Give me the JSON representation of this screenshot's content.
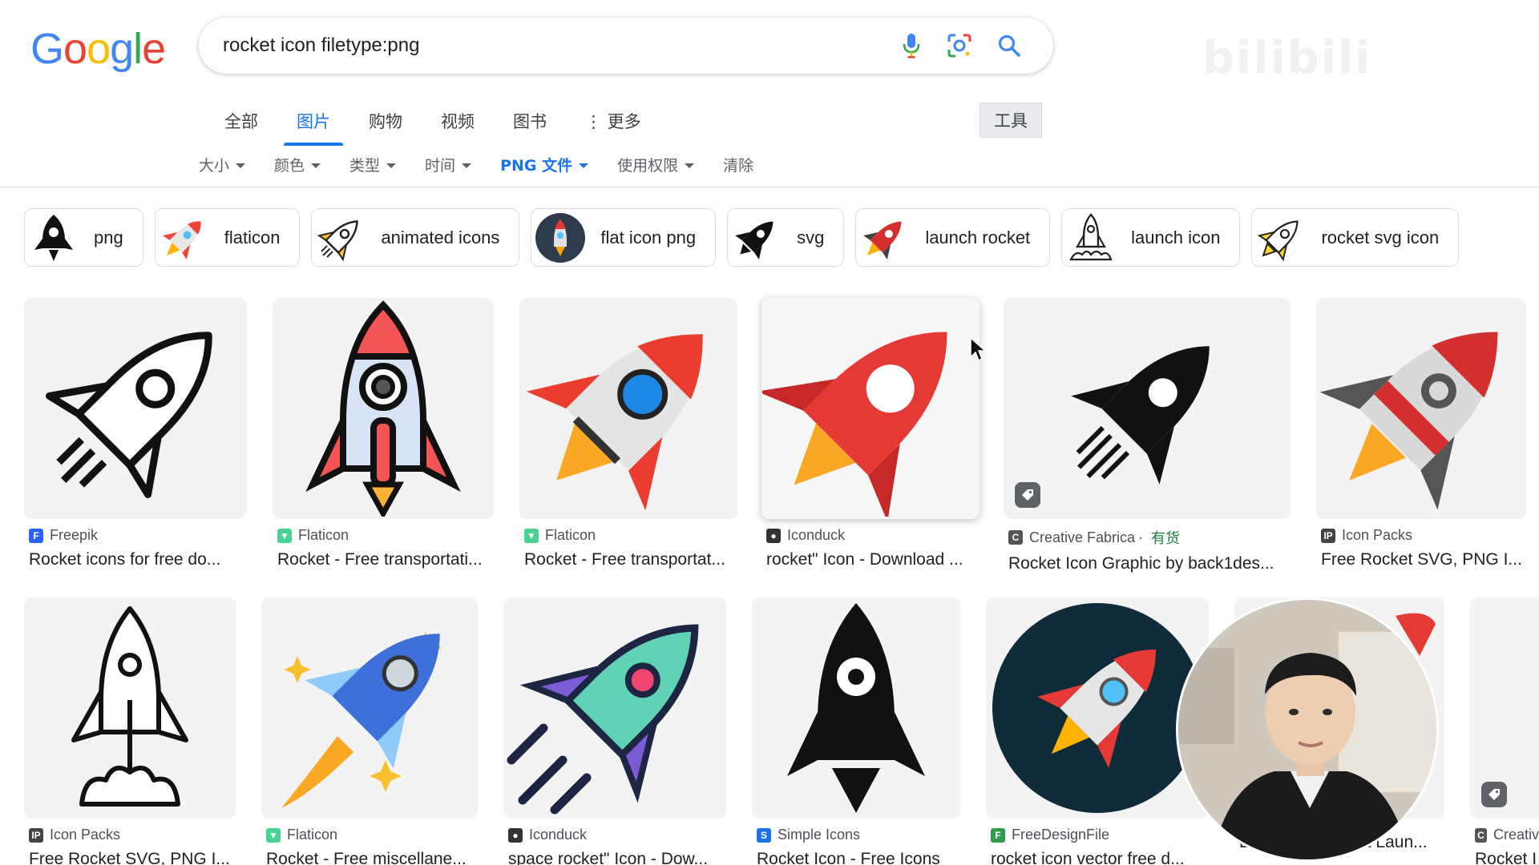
{
  "logo": {
    "letters": [
      "G",
      "o",
      "o",
      "g",
      "l",
      "e"
    ],
    "colors": [
      "#4285f4",
      "#ea4335",
      "#fbbc05",
      "#4285f4",
      "#34a853",
      "#ea4335"
    ]
  },
  "search": {
    "query": "rocket icon filetype:png",
    "icons": [
      "microphone-icon",
      "lens-icon",
      "search-icon"
    ]
  },
  "tabs": [
    {
      "label": "全部",
      "active": false
    },
    {
      "label": "图片",
      "active": true
    },
    {
      "label": "购物",
      "active": false
    },
    {
      "label": "视频",
      "active": false
    },
    {
      "label": "图书",
      "active": false
    },
    {
      "label": "⋮ 更多",
      "active": false
    }
  ],
  "tools_label": "工具",
  "filters": [
    {
      "label": "大小",
      "dropdown": true,
      "active": false
    },
    {
      "label": "颜色",
      "dropdown": true,
      "active": false
    },
    {
      "label": "类型",
      "dropdown": true,
      "active": false
    },
    {
      "label": "时间",
      "dropdown": true,
      "active": false
    },
    {
      "label": "PNG 文件",
      "dropdown": true,
      "active": true
    },
    {
      "label": "使用权限",
      "dropdown": true,
      "active": false
    },
    {
      "label": "清除",
      "dropdown": false,
      "active": false
    }
  ],
  "chips": [
    {
      "label": "png"
    },
    {
      "label": "flaticon"
    },
    {
      "label": "animated icons"
    },
    {
      "label": "flat icon png"
    },
    {
      "label": "svg"
    },
    {
      "label": "launch rocket"
    },
    {
      "label": "launch icon"
    },
    {
      "label": "rocket svg icon"
    }
  ],
  "results_row1": [
    {
      "source": "Freepik",
      "source_color": "#2a62ff",
      "title": "Rocket icons for free do...",
      "stock": ""
    },
    {
      "source": "Flaticon",
      "source_color": "#4ad295",
      "title": "Rocket - Free transportati...",
      "stock": ""
    },
    {
      "source": "Flaticon",
      "source_color": "#4ad295",
      "title": "Rocket - Free transportat...",
      "stock": ""
    },
    {
      "source": "Iconduck",
      "source_color": "#333333",
      "title": "rocket\" Icon - Download ...",
      "stock": ""
    },
    {
      "source": "Creative Fabrica",
      "source_color": "#555555",
      "title": "Rocket Icon Graphic by back1des...",
      "stock": "有货"
    },
    {
      "source": "Icon Packs",
      "source_color": "#444444",
      "title": "Free Rocket SVG, PNG I...",
      "stock": ""
    }
  ],
  "results_row2": [
    {
      "source": "Icon Packs",
      "source_color": "#444444",
      "title": "Free Rocket SVG, PNG I..."
    },
    {
      "source": "Flaticon",
      "source_color": "#4ad295",
      "title": "Rocket - Free miscellane..."
    },
    {
      "source": "Iconduck",
      "source_color": "#333333",
      "title": "space rocket\" Icon - Dow..."
    },
    {
      "source": "Simple Icons",
      "source_color": "#1a73e8",
      "title": "Rocket Icon - Free Icons"
    },
    {
      "source": "FreeDesignFile",
      "source_color": "#2e9c4a",
      "title": "rocket icon vector free d..."
    },
    {
      "source": "",
      "source_color": "#888888",
      "title": "Download Rocket Laun..."
    },
    {
      "source": "Creativ",
      "source_color": "#555555",
      "title": "Rocket I"
    }
  ]
}
